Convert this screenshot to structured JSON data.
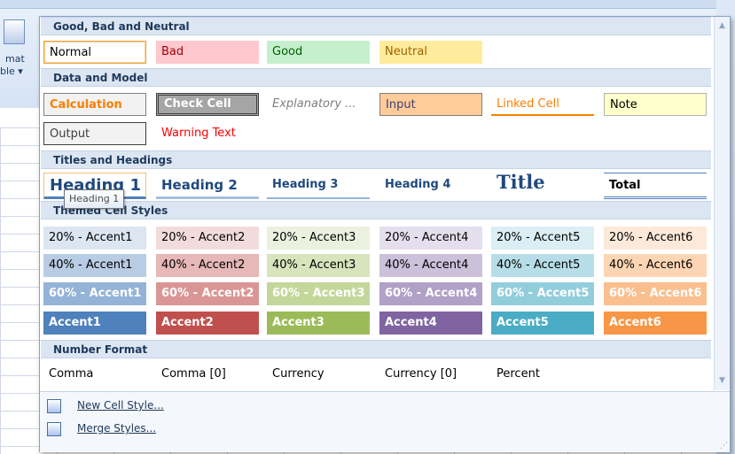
{
  "background": {
    "format_label_line1": "mat",
    "format_label_line2": "ble ▾"
  },
  "colors": {
    "bad_bg": "#ffc7ce",
    "bad_fg": "#9c0006",
    "good_bg": "#c6efce",
    "good_fg": "#006100",
    "neutral_bg": "#ffeb9c",
    "neutral_fg": "#9c6500",
    "header_bg": "#dce6f2",
    "header_fg": "#1e395b",
    "accent1": "#4f81bd",
    "accent2": "#c0504d",
    "accent3": "#9bbb59",
    "accent4": "#8064a2",
    "accent5": "#4bacc6",
    "accent6": "#f79646"
  },
  "sections": {
    "good_bad": "Good, Bad and Neutral",
    "data_model": "Data and Model",
    "titles": "Titles and Headings",
    "themed": "Themed Cell Styles",
    "number_format": "Number Format"
  },
  "styles": {
    "normal": "Normal",
    "bad": "Bad",
    "good": "Good",
    "neutral": "Neutral",
    "calculation": "Calculation",
    "check_cell": "Check Cell",
    "explanatory": "Explanatory ...",
    "input": "Input",
    "linked_cell": "Linked Cell",
    "note": "Note",
    "output": "Output",
    "warning": "Warning Text",
    "heading1": "Heading 1",
    "heading2": "Heading 2",
    "heading3": "Heading 3",
    "heading4": "Heading 4",
    "title": "Title",
    "total": "Total",
    "a20_1": "20% - Accent1",
    "a20_2": "20% - Accent2",
    "a20_3": "20% - Accent3",
    "a20_4": "20% - Accent4",
    "a20_5": "20% - Accent5",
    "a20_6": "20% - Accent6",
    "a40_1": "40% - Accent1",
    "a40_2": "40% - Accent2",
    "a40_3": "40% - Accent3",
    "a40_4": "40% - Accent4",
    "a40_5": "40% - Accent5",
    "a40_6": "40% - Accent6",
    "a60_1": "60% - Accent1",
    "a60_2": "60% - Accent2",
    "a60_3": "60% - Accent3",
    "a60_4": "60% - Accent4",
    "a60_5": "60% - Accent5",
    "a60_6": "60% - Accent6",
    "acc1": "Accent1",
    "acc2": "Accent2",
    "acc3": "Accent3",
    "acc4": "Accent4",
    "acc5": "Accent5",
    "acc6": "Accent6",
    "comma": "Comma",
    "comma0": "Comma [0]",
    "currency": "Currency",
    "currency0": "Currency [0]",
    "percent": "Percent"
  },
  "tooltip": "Heading 1",
  "menu": {
    "new_style": "New Cell Style...",
    "merge_styles": "Merge Styles..."
  },
  "icons": {
    "new_style": "new-cell-style-icon",
    "merge_styles": "merge-styles-icon",
    "scroll_up": "scroll-up-arrow-icon",
    "scroll_down": "scroll-down-arrow-icon"
  }
}
